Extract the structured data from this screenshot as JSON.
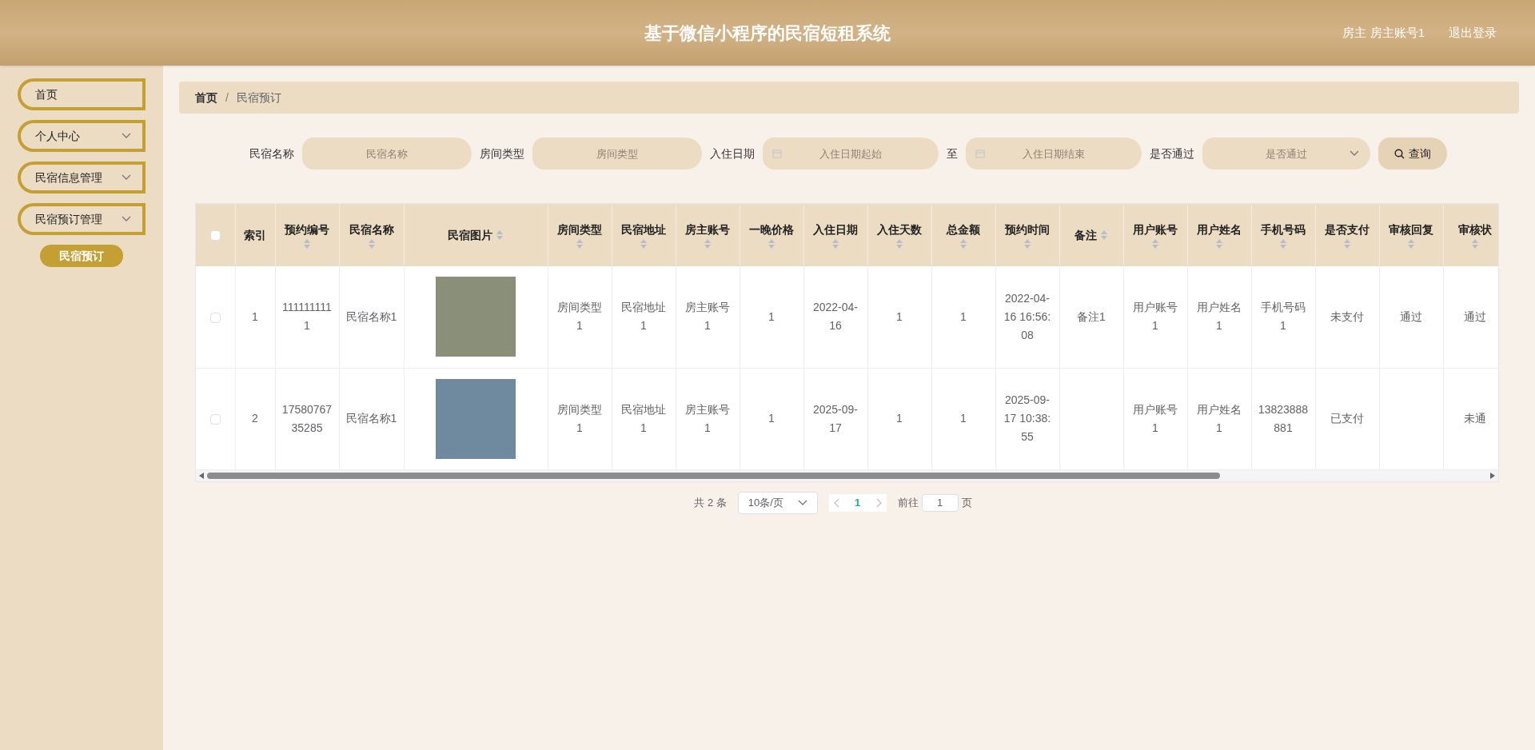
{
  "header": {
    "title": "基于微信小程序的民宿短租系统",
    "user": "房主 房主账号1",
    "logout": "退出登录"
  },
  "sidebar": {
    "items": [
      {
        "label": "首页",
        "has_submenu": false
      },
      {
        "label": "个人中心",
        "has_submenu": true
      },
      {
        "label": "民宿信息管理",
        "has_submenu": true
      },
      {
        "label": "民宿预订管理",
        "has_submenu": true,
        "children": [
          {
            "label": "民宿预订",
            "selected": true
          }
        ]
      }
    ]
  },
  "breadcrumb": {
    "items": [
      "首页",
      "民宿预订"
    ],
    "separator": "/"
  },
  "search": {
    "fields": [
      {
        "kind": "text",
        "label": "民宿名称",
        "placeholder": "民宿名称"
      },
      {
        "kind": "text",
        "label": "房间类型",
        "placeholder": "房间类型"
      },
      {
        "kind": "date",
        "label": "入住日期",
        "placeholder": "入住日期起始"
      },
      {
        "kind": "date",
        "label": "至",
        "placeholder": "入住日期结束"
      },
      {
        "kind": "select",
        "label": "是否通过",
        "placeholder": "是否通过"
      }
    ],
    "button": "查询"
  },
  "table": {
    "all_checked": false,
    "columns": [
      {
        "label": "索引",
        "sortable": false,
        "kind": "text"
      },
      {
        "label": "预约编号",
        "sortable": true,
        "kind": "text"
      },
      {
        "label": "民宿名称",
        "sortable": true,
        "kind": "text"
      },
      {
        "label": "民宿图片",
        "sortable": true,
        "kind": "image"
      },
      {
        "label": "房间类型",
        "sortable": true,
        "kind": "text"
      },
      {
        "label": "民宿地址",
        "sortable": true,
        "kind": "text"
      },
      {
        "label": "房主账号",
        "sortable": true,
        "kind": "text"
      },
      {
        "label": "一晚价格",
        "sortable": true,
        "kind": "text"
      },
      {
        "label": "入住日期",
        "sortable": true,
        "kind": "text"
      },
      {
        "label": "入住天数",
        "sortable": true,
        "kind": "text"
      },
      {
        "label": "总金额",
        "sortable": true,
        "kind": "text"
      },
      {
        "label": "预约时间",
        "sortable": true,
        "kind": "text"
      },
      {
        "label": "备注",
        "sortable": true,
        "kind": "text"
      },
      {
        "label": "用户账号",
        "sortable": true,
        "kind": "text"
      },
      {
        "label": "用户姓名",
        "sortable": true,
        "kind": "text"
      },
      {
        "label": "手机号码",
        "sortable": true,
        "kind": "text"
      },
      {
        "label": "是否支付",
        "sortable": true,
        "kind": "text"
      },
      {
        "label": "审核回复",
        "sortable": true,
        "kind": "text"
      },
      {
        "label": "审核状",
        "sortable": true,
        "kind": "text"
      }
    ],
    "rows": [
      {
        "checked": false,
        "index": "1",
        "order_no": "1111111111",
        "homestay_name": "民宿名称1",
        "room_type": "房间类型1",
        "address": "民宿地址1",
        "host_account": "房主账号1",
        "price": "1",
        "checkin_date": "2022-04-16",
        "days": "1",
        "total": "1",
        "booked_at": "2022-04-16 16:56:08",
        "note": "备注1",
        "user_account": "用户账号1",
        "user_name": "用户姓名1",
        "phone": "手机号码1",
        "paid": "未支付",
        "review_reply": "通过",
        "review_status": "通过"
      },
      {
        "checked": false,
        "index": "2",
        "order_no": "1758076735285",
        "homestay_name": "民宿名称1",
        "room_type": "房间类型1",
        "address": "民宿地址1",
        "host_account": "房主账号1",
        "price": "1",
        "checkin_date": "2025-09-17",
        "days": "1",
        "total": "1",
        "booked_at": "2025-09-17 10:38:55",
        "user_account": "用户账号1",
        "user_name": "用户姓名1",
        "phone": "13823888881",
        "paid": "已支付",
        "review_status": "未通"
      }
    ]
  },
  "pagination": {
    "total": "共 2 条",
    "page_size": "10条/页",
    "pages": [
      {
        "label": "1",
        "selected": true
      }
    ],
    "goto_label": "前往",
    "goto_value": "1",
    "goto_suffix": "页"
  }
}
